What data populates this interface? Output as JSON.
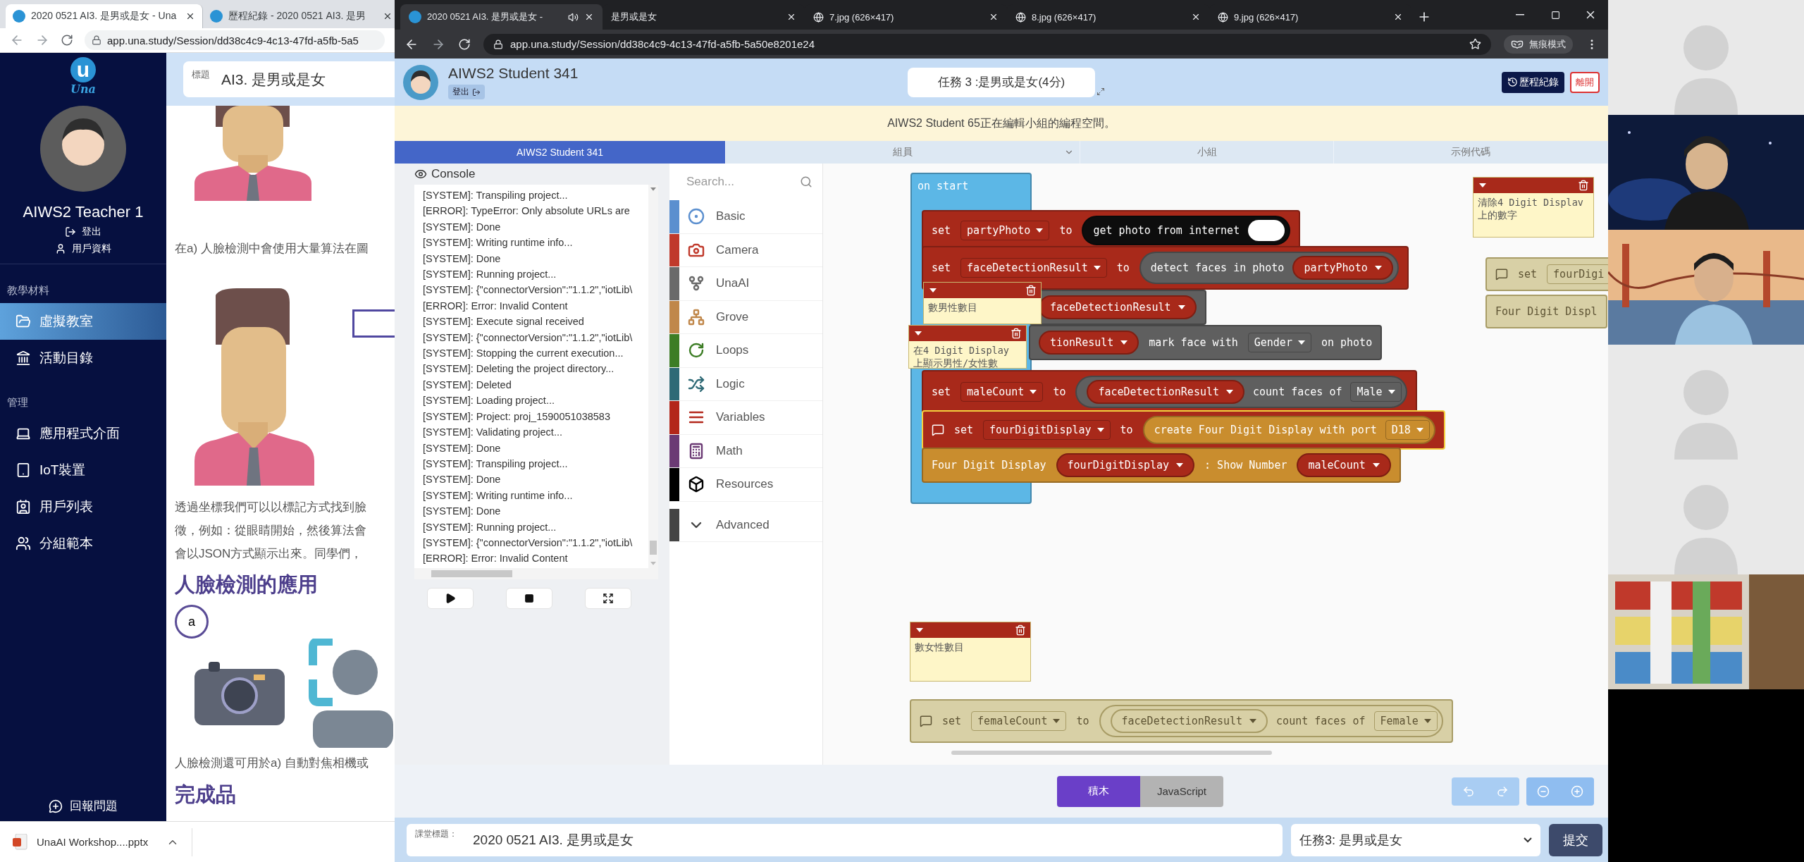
{
  "left_window": {
    "tabs": [
      {
        "title": "2020 0521 AI3. 是男或是女 - Una",
        "selected": true
      },
      {
        "title": "歷程紀錄 - 2020 0521 AI3. 是男",
        "selected": false
      }
    ],
    "url": "app.una.study/Session/dd38c4c9-4c13-47fd-a5fb-5a5",
    "sidebar": {
      "logo_mark": "u",
      "logo_text": "Una",
      "user_name": "AIWS2 Teacher 1",
      "links": [
        {
          "label": "登出"
        },
        {
          "label": "用戶資料"
        }
      ],
      "sections": [
        {
          "title": "教學材料",
          "items": [
            {
              "label": "虛擬教室",
              "selected": true
            },
            {
              "label": "活動目錄",
              "selected": false
            }
          ]
        },
        {
          "title": "管理",
          "items": [
            {
              "label": "應用程式介面",
              "selected": false
            },
            {
              "label": "IoT裝置",
              "selected": false
            },
            {
              "label": "用戶列表",
              "selected": false
            },
            {
              "label": "分組範本",
              "selected": false
            }
          ]
        }
      ],
      "report": "回報問題"
    },
    "content": {
      "title_label": "標題",
      "title_value": "AI3. 是男或是女",
      "items": [
        {
          "kind": "figure"
        },
        {
          "kind": "text",
          "text": "在a) 人臉檢測中會使用大量算法在圖"
        },
        {
          "kind": "figure"
        },
        {
          "kind": "lines",
          "lines": [
            "透過坐標我們可以以標記方式找到臉",
            "徵，例如：從眼睛開始，然後算法會",
            "會以JSON方式顯示出來。同學們，"
          ]
        },
        {
          "kind": "heading",
          "text": "人臉檢測的應用"
        },
        {
          "kind": "badge",
          "text": "a"
        },
        {
          "kind": "icons"
        },
        {
          "kind": "text",
          "text": "人臉檢測還可用於a) 自動對焦相機或"
        },
        {
          "kind": "heading",
          "text": "完成品"
        }
      ]
    },
    "download": {
      "file": "UnaAI Workshop....pptx"
    }
  },
  "main_window": {
    "tabs": [
      {
        "title": "2020 0521 AI3. 是男或是女 -",
        "kind": "una",
        "audio": true,
        "selected": true
      },
      {
        "title": "是男或是女",
        "kind": "blank",
        "audio": false,
        "selected": false
      },
      {
        "title": "7.jpg (626×417)",
        "audio": false,
        "selected": false
      },
      {
        "title": "8.jpg (626×417)",
        "audio": false,
        "selected": false
      },
      {
        "title": "9.jpg (626×417)",
        "audio": false,
        "selected": false
      }
    ],
    "url": "app.una.study/Session/dd38c4c9-4c13-47fd-a5fb-5a50e8201e24",
    "profile": "無痕模式",
    "header": {
      "student": "AIWS2 Student 341",
      "logout": "登出",
      "task": "任務 3 :是男或是女(4分)",
      "history": "歷程紀錄",
      "leave": "離開"
    },
    "notice": "AIWS2 Student 65正在編輯小組的編程空間。",
    "panel_tabs": [
      {
        "label": "AIWS2 Student 341",
        "dropdown": false,
        "selected": true
      },
      {
        "label": "組員",
        "dropdown": true,
        "selected": false
      },
      {
        "label": "小組",
        "dropdown": false,
        "selected": false
      },
      {
        "label": "示例代碼",
        "dropdown": false,
        "selected": false
      }
    ],
    "console": {
      "title": "Console",
      "lines": [
        "[SYSTEM]: Transpiling project...",
        "[ERROR]: TypeError: Only absolute URLs are",
        "[SYSTEM]: Done",
        "[SYSTEM]: Writing runtime info...",
        "[SYSTEM]: Done",
        "[SYSTEM]: Running project...",
        "[SYSTEM]: {\"connectorVersion\":\"1.1.2\",\"iotLib\\",
        "[ERROR]: Error: Invalid Content",
        "[SYSTEM]: Execute signal received",
        "[SYSTEM]: {\"connectorVersion\":\"1.1.2\",\"iotLib\\",
        "[SYSTEM]: Stopping the current execution...",
        "[SYSTEM]: Deleting the project directory...",
        "[SYSTEM]: Deleted",
        "[SYSTEM]: Loading project...",
        "[SYSTEM]: Project: proj_1590051038583",
        "[SYSTEM]: Validating project...",
        "[SYSTEM]: Done",
        "[SYSTEM]: Transpiling project...",
        "[SYSTEM]: Done",
        "[SYSTEM]: Writing runtime info...",
        "[SYSTEM]: Done",
        "[SYSTEM]: Running project...",
        "[SYSTEM]: {\"connectorVersion\":\"1.1.2\",\"iotLib\\",
        "[ERROR]: Error: Invalid Content"
      ]
    },
    "toolbox": {
      "placeholder": "Search...",
      "categories": [
        {
          "label": "Basic",
          "color": "#5b8fcf"
        },
        {
          "label": "Camera",
          "color": "#c0392b"
        },
        {
          "label": "UnaAI",
          "color": "#6a6a6a"
        },
        {
          "label": "Grove",
          "color": "#c0874a"
        },
        {
          "label": "Loops",
          "color": "#3c7d25"
        },
        {
          "label": "Logic",
          "color": "#2f6a76"
        },
        {
          "label": "Variables",
          "color": "#b3271a"
        },
        {
          "label": "Math",
          "color": "#6b3a74"
        },
        {
          "label": "Resources",
          "color": "#000000"
        },
        {
          "label": "Advanced",
          "color": "#444444"
        }
      ]
    },
    "workspace": {
      "blocks": [
        {
          "kind": "hat",
          "color": "#5cb7e6",
          "disabled": false,
          "selected": false,
          "parts": [
            {
              "kind": "label",
              "text": "on start"
            }
          ]
        },
        {
          "kind": "statement",
          "color": "#a8291a",
          "disabled": false,
          "selected": false,
          "parts": [
            {
              "kind": "label",
              "text": "set"
            },
            {
              "kind": "field",
              "text": "partyPhoto"
            },
            {
              "kind": "label",
              "text": "to"
            },
            {
              "kind": "reporter",
              "color": "#0d0d0d",
              "parts": [
                {
                  "kind": "label",
                  "text": "get photo from internet"
                },
                {
                  "kind": "toggle"
                }
              ]
            }
          ]
        },
        {
          "kind": "statement",
          "color": "#a8291a",
          "disabled": false,
          "selected": false,
          "parts": [
            {
              "kind": "label",
              "text": "set"
            },
            {
              "kind": "field",
              "text": "faceDetectionResult"
            },
            {
              "kind": "label",
              "text": "to"
            },
            {
              "kind": "reporter",
              "color": "#5f5f5f",
              "parts": [
                {
                  "kind": "label",
                  "text": "detect faces in photo"
                },
                {
                  "kind": "variable",
                  "text": "partyPhoto"
                }
              ]
            }
          ]
        },
        {
          "kind": "statement",
          "color": "#5f5f5f",
          "disabled": false,
          "selected": false,
          "parts": [
            {
              "kind": "variable",
              "text": "faceDetectionResult"
            }
          ]
        },
        {
          "kind": "statement",
          "color": "#5f5f5f",
          "disabled": false,
          "selected": false,
          "parts": [
            {
              "kind": "variable",
              "text": "tionResult"
            },
            {
              "kind": "label",
              "text": "mark face with"
            },
            {
              "kind": "field",
              "text": "Gender"
            },
            {
              "kind": "label",
              "text": "on photo"
            }
          ]
        },
        {
          "kind": "statement",
          "color": "#a8291a",
          "disabled": false,
          "selected": false,
          "parts": [
            {
              "kind": "label",
              "text": "set"
            },
            {
              "kind": "field",
              "text": "maleCount"
            },
            {
              "kind": "label",
              "text": "to"
            },
            {
              "kind": "reporter",
              "color": "#5f5f5f",
              "parts": [
                {
                  "kind": "variable",
                  "text": "faceDetectionResult"
                },
                {
                  "kind": "label",
                  "text": "count faces of"
                },
                {
                  "kind": "field",
                  "text": "Male"
                }
              ]
            }
          ]
        },
        {
          "kind": "statement",
          "color": "#a8291a",
          "disabled": false,
          "selected": true,
          "parts": [
            {
              "kind": "comment"
            },
            {
              "kind": "label",
              "text": "set"
            },
            {
              "kind": "field",
              "text": "fourDigitDisplay"
            },
            {
              "kind": "label",
              "text": "to"
            },
            {
              "kind": "reporter",
              "color": "#c98d2e",
              "parts": [
                {
                  "kind": "label",
                  "text": "create Four Digit Display with port"
                },
                {
                  "kind": "field",
                  "text": "D18"
                }
              ]
            }
          ]
        },
        {
          "kind": "statement",
          "color": "#c98d2e",
          "disabled": false,
          "selected": false,
          "parts": [
            {
              "kind": "label",
              "text": "Four Digit Display"
            },
            {
              "kind": "variable",
              "text": "fourDigitDisplay"
            },
            {
              "kind": "label",
              "text": ": Show Number"
            },
            {
              "kind": "variable",
              "text": "maleCount"
            }
          ]
        },
        {
          "kind": "statement",
          "disabled": true,
          "selected": false,
          "parts": [
            {
              "kind": "comment"
            },
            {
              "kind": "label",
              "text": "set"
            },
            {
              "kind": "clipped",
              "text": "fourDigi"
            }
          ]
        },
        {
          "kind": "statement",
          "disabled": true,
          "selected": false,
          "parts": [
            {
              "kind": "label",
              "text": "Four Digit Displ"
            }
          ]
        },
        {
          "kind": "statement",
          "disabled": true,
          "selected": false,
          "parts": [
            {
              "kind": "comment"
            },
            {
              "kind": "label",
              "text": "set"
            },
            {
              "kind": "field",
              "text": "femaleCount"
            },
            {
              "kind": "label",
              "text": "to"
            },
            {
              "kind": "reporter",
              "parts": [
                {
                  "kind": "variable",
                  "text": "faceDetectionResult"
                },
                {
                  "kind": "label",
                  "text": "count faces of"
                },
                {
                  "kind": "field",
                  "text": "Female"
                }
              ]
            }
          ]
        }
      ],
      "comments": [
        {
          "text": "清除4 Digit Displav上的數字"
        },
        {
          "text": "數男性數目"
        },
        {
          "text": "在4 Digit Display 上顯示男性/女性數"
        },
        {
          "text": "數女性數目"
        }
      ]
    },
    "editor_modes": [
      {
        "label": "積木",
        "selected": true
      },
      {
        "label": "JavaScript",
        "selected": false
      }
    ],
    "footer": {
      "field_label": "課堂標題：",
      "field_value": "2020 0521 AI3. 是男或是女",
      "task_select": "任務3: 是男或是女",
      "submit": "提交"
    }
  },
  "video_tiles": [
    {
      "kind": "avatar"
    },
    {
      "kind": "picture"
    },
    {
      "kind": "picture"
    },
    {
      "kind": "avatar"
    },
    {
      "kind": "avatar"
    },
    {
      "kind": "picture"
    }
  ]
}
